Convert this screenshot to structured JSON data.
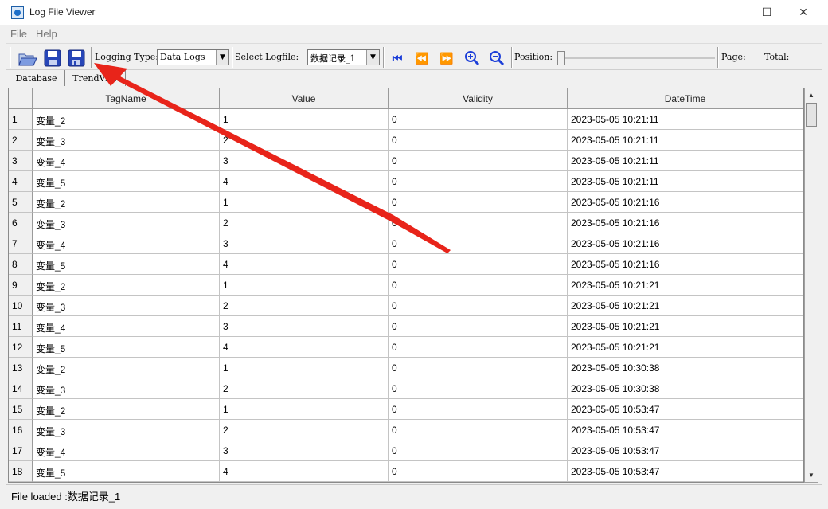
{
  "window": {
    "title": "Log File Viewer",
    "min": "—",
    "max": "☐",
    "close": "✕"
  },
  "menu": [
    "File",
    "Help"
  ],
  "toolbar": {
    "logging_type_label": "Logging Type:",
    "logging_type_value": "Data Logs",
    "select_logfile_label": "Select Logfile:",
    "select_logfile_value": "数据记录_1",
    "position_label": "Position:",
    "page_label": "Page:",
    "total_label": "Total:",
    "position_fraction": 0.0
  },
  "tabs": [
    "Database",
    "TrendView"
  ],
  "table": {
    "columns": [
      "TagName",
      "Value",
      "Validity",
      "DateTime"
    ],
    "rows": [
      {
        "n": "1",
        "tag": "变量_2",
        "value": "1",
        "validity": "0",
        "dt": "2023-05-05 10:21:11"
      },
      {
        "n": "2",
        "tag": "变量_3",
        "value": "2",
        "validity": "0",
        "dt": "2023-05-05 10:21:11"
      },
      {
        "n": "3",
        "tag": "变量_4",
        "value": "3",
        "validity": "0",
        "dt": "2023-05-05 10:21:11"
      },
      {
        "n": "4",
        "tag": "变量_5",
        "value": "4",
        "validity": "0",
        "dt": "2023-05-05 10:21:11"
      },
      {
        "n": "5",
        "tag": "变量_2",
        "value": "1",
        "validity": "0",
        "dt": "2023-05-05 10:21:16"
      },
      {
        "n": "6",
        "tag": "变量_3",
        "value": "2",
        "validity": "0",
        "dt": "2023-05-05 10:21:16"
      },
      {
        "n": "7",
        "tag": "变量_4",
        "value": "3",
        "validity": "0",
        "dt": "2023-05-05 10:21:16"
      },
      {
        "n": "8",
        "tag": "变量_5",
        "value": "4",
        "validity": "0",
        "dt": "2023-05-05 10:21:16"
      },
      {
        "n": "9",
        "tag": "变量_2",
        "value": "1",
        "validity": "0",
        "dt": "2023-05-05 10:21:21"
      },
      {
        "n": "10",
        "tag": "变量_3",
        "value": "2",
        "validity": "0",
        "dt": "2023-05-05 10:21:21"
      },
      {
        "n": "11",
        "tag": "变量_4",
        "value": "3",
        "validity": "0",
        "dt": "2023-05-05 10:21:21"
      },
      {
        "n": "12",
        "tag": "变量_5",
        "value": "4",
        "validity": "0",
        "dt": "2023-05-05 10:21:21"
      },
      {
        "n": "13",
        "tag": "变量_2",
        "value": "1",
        "validity": "0",
        "dt": "2023-05-05 10:30:38"
      },
      {
        "n": "14",
        "tag": "变量_3",
        "value": "2",
        "validity": "0",
        "dt": "2023-05-05 10:30:38"
      },
      {
        "n": "15",
        "tag": "变量_2",
        "value": "1",
        "validity": "0",
        "dt": "2023-05-05 10:53:47"
      },
      {
        "n": "16",
        "tag": "变量_3",
        "value": "2",
        "validity": "0",
        "dt": "2023-05-05 10:53:47"
      },
      {
        "n": "17",
        "tag": "变量_4",
        "value": "3",
        "validity": "0",
        "dt": "2023-05-05 10:53:47"
      },
      {
        "n": "18",
        "tag": "变量_5",
        "value": "4",
        "validity": "0",
        "dt": "2023-05-05 10:53:47"
      }
    ]
  },
  "status": {
    "text": "File loaded :数据记录_1"
  },
  "colors": {
    "annotation_arrow": "#e8241a",
    "toolbar_icon": "#1d3fd8"
  },
  "icons": [
    "app-icon",
    "open-folder-icon",
    "save-icon",
    "save-as-icon",
    "first-page-icon",
    "previous-page-icon",
    "next-page-icon",
    "zoom-in-icon",
    "zoom-out-icon"
  ]
}
